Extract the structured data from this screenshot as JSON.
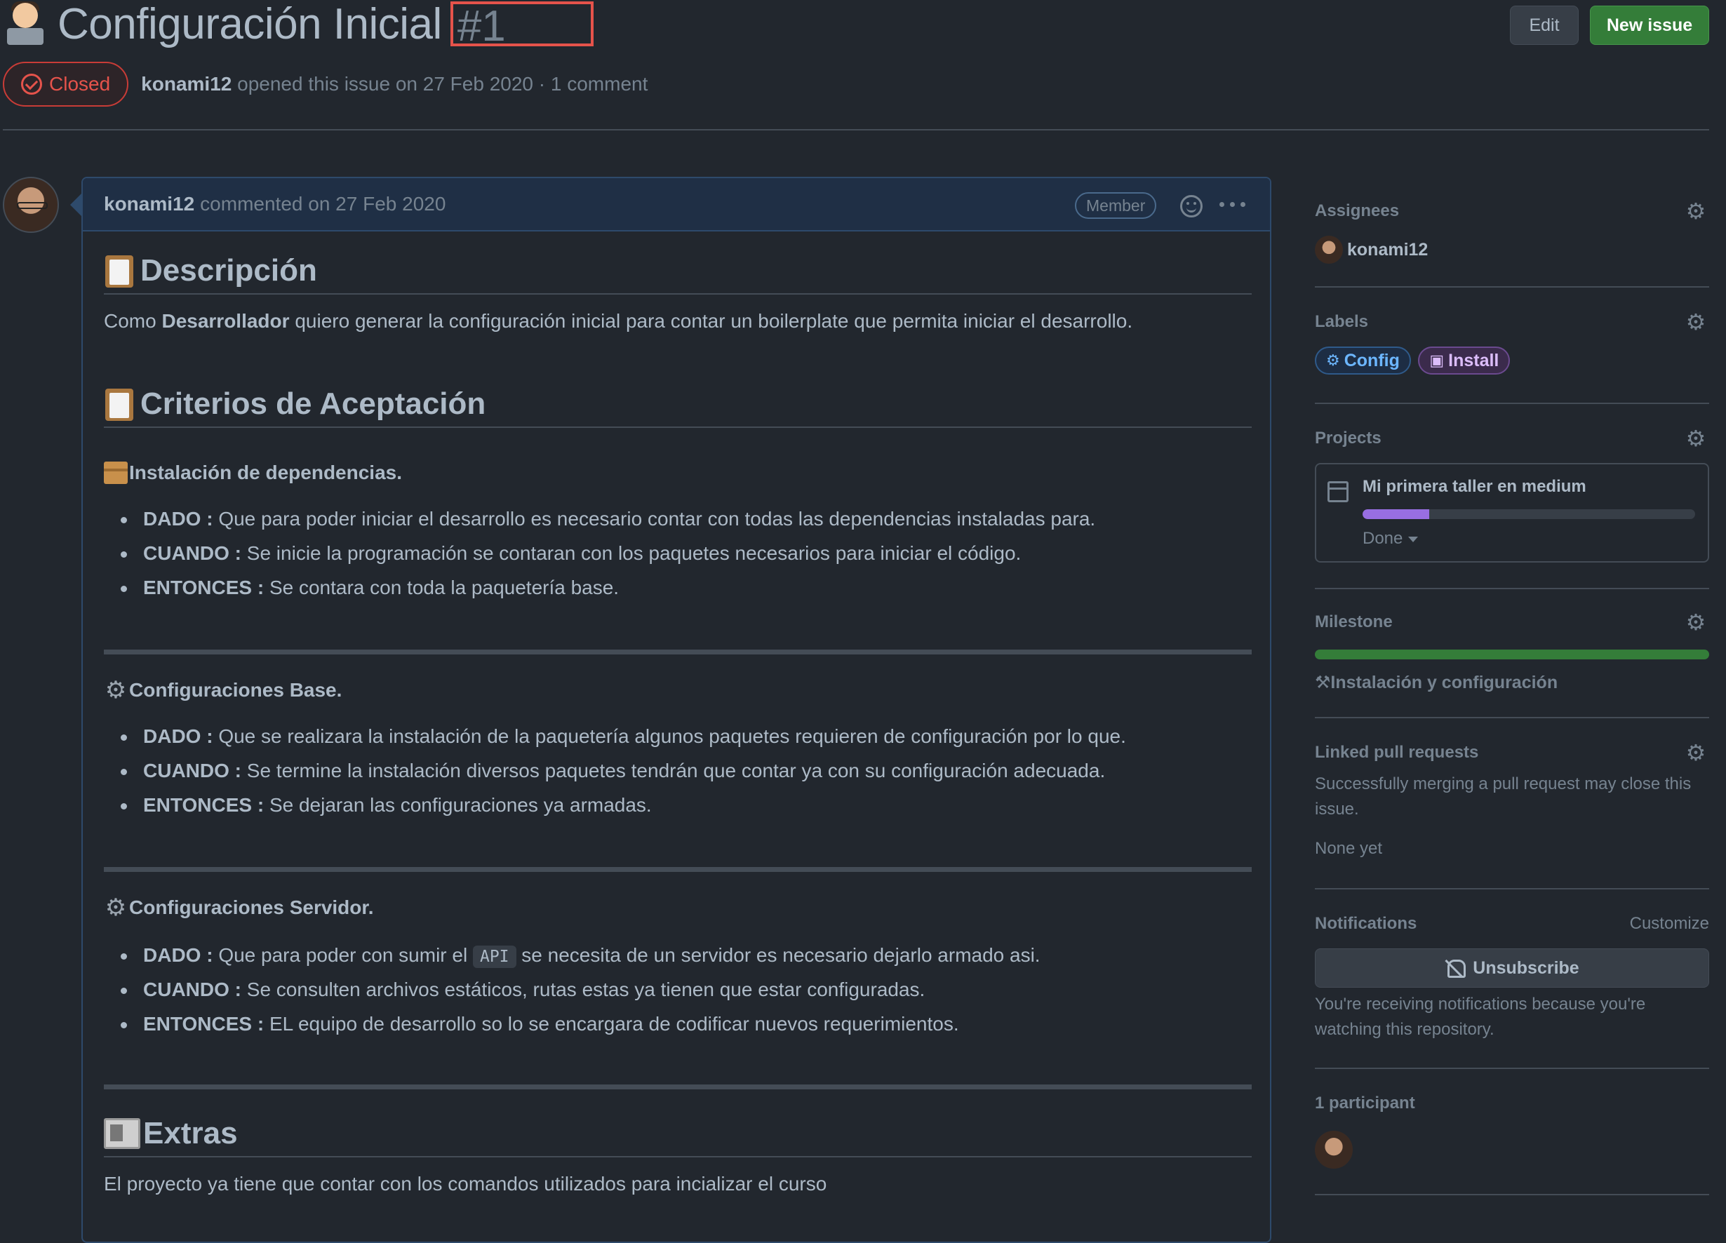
{
  "issue": {
    "title": "Configuración Inicial",
    "number": "#1",
    "state": "Closed",
    "author": "konami12",
    "meta": "opened this issue on 27 Feb 2020 · 1 comment"
  },
  "header_buttons": {
    "edit": "Edit",
    "new_issue": "New issue"
  },
  "comment": {
    "author": "konami12",
    "meta": "commented on 27 Feb 2020",
    "badge": "Member",
    "descripcion_title": "Descripción",
    "descripcion_pre": "Como ",
    "descripcion_bold": "Desarrollador",
    "descripcion_post": " quiero generar la configuración inicial para contar un boilerplate que permita iniciar el desarrollo.",
    "criterios_title": "Criterios de Aceptación",
    "sections": [
      {
        "title": "Instalación de dependencias.",
        "items": [
          {
            "key": "DADO :",
            "text": " Que para poder iniciar el desarrollo es necesario contar con todas las dependencias instaladas para."
          },
          {
            "key": "CUANDO :",
            "text": " Se inicie la programación se contaran con los paquetes necesarios para iniciar el código."
          },
          {
            "key": "ENTONCES :",
            "text": " Se contara con toda la paquetería base."
          }
        ]
      },
      {
        "title": "Configuraciones Base.",
        "items": [
          {
            "key": "DADO :",
            "text": " Que se realizara la instalación de la paquetería algunos paquetes requieren de configuración por lo que."
          },
          {
            "key": "CUANDO :",
            "text": " Se termine la instalación diversos paquetes tendrán que contar ya con su configuración adecuada."
          },
          {
            "key": "ENTONCES :",
            "text": " Se dejaran las configuraciones ya armadas."
          }
        ]
      },
      {
        "title": "Configuraciones Servidor.",
        "items": [
          {
            "key": "DADO :",
            "text_pre": " Que para poder con sumir el ",
            "code": "API",
            "text_post": " se necesita de un servidor es necesario dejarlo armado asi."
          },
          {
            "key": "CUANDO :",
            "text": " Se consulten archivos estáticos, rutas estas ya tienen que estar configuradas."
          },
          {
            "key": "ENTONCES :",
            "text": " EL equipo de desarrollo so lo se encargara de codificar nuevos requerimientos."
          }
        ]
      }
    ],
    "extras_title": "Extras",
    "extras_text": "El proyecto ya tiene que contar con los comandos utilizados para incializar el curso"
  },
  "sidebar": {
    "assignees": {
      "title": "Assignees",
      "user": "konami12"
    },
    "labels": {
      "title": "Labels",
      "items": [
        {
          "name": "Config",
          "icon": "gear-icon"
        },
        {
          "name": "Install",
          "icon": "package-icon"
        }
      ]
    },
    "projects": {
      "title": "Projects",
      "name": "Mi primera taller en medium",
      "progress": 0.2,
      "status": "Done"
    },
    "milestone": {
      "title": "Milestone",
      "progress": 1.0,
      "name": "Instalación y configuración"
    },
    "linked_prs": {
      "title": "Linked pull requests",
      "text": "Successfully merging a pull request may close this issue.",
      "none": "None yet"
    },
    "notifications": {
      "title": "Notifications",
      "customize": "Customize",
      "unsubscribe": "Unsubscribe",
      "reason": "You're receiving notifications because you're watching this repository."
    },
    "participants": {
      "title": "1 participant"
    }
  },
  "colors": {
    "closed": "#e5534b",
    "new_issue": "#347d39",
    "project_bar": "#986ee2",
    "milestone_bar": "#347d39"
  }
}
